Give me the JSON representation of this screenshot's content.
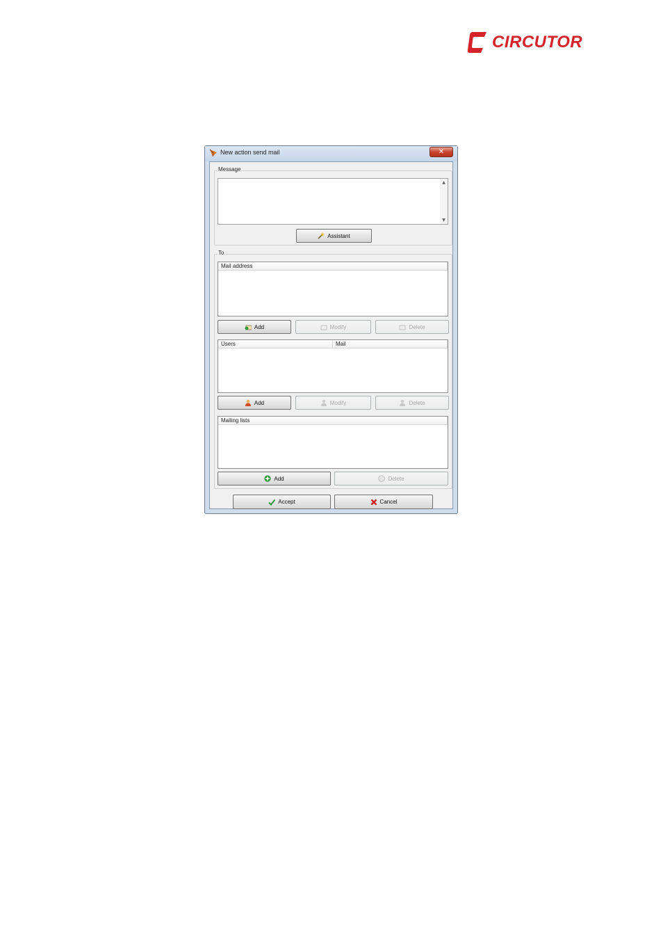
{
  "brand": {
    "logo_text": "CIRCUTOR",
    "color": "#d5232a"
  },
  "window": {
    "title": "New action send mail",
    "close_symbol": "✕"
  },
  "message": {
    "group_label": "Message",
    "text": "",
    "assistant_label": "Assistant"
  },
  "to": {
    "group_label": "To",
    "mail_address": {
      "column": "Mail address",
      "rows": [],
      "add_label": "Add",
      "modify_label": "Modify",
      "delete_label": "Delete"
    },
    "users": {
      "columns": [
        "Users",
        "Mail"
      ],
      "rows": [],
      "add_label": "Add",
      "modify_label": "Modify",
      "delete_label": "Delete"
    },
    "mailing_lists": {
      "column": "Mailing lists",
      "rows": [],
      "add_label": "Add",
      "delete_label": "Delete"
    }
  },
  "footer": {
    "accept_label": "Accept",
    "cancel_label": "Cancel"
  },
  "icons": {
    "assistant": "wand-icon",
    "mail_add": "mail-add-icon",
    "user_add": "user-add-icon",
    "list_add": "plus-circle-icon",
    "accept": "check-icon",
    "cancel": "x-icon"
  }
}
